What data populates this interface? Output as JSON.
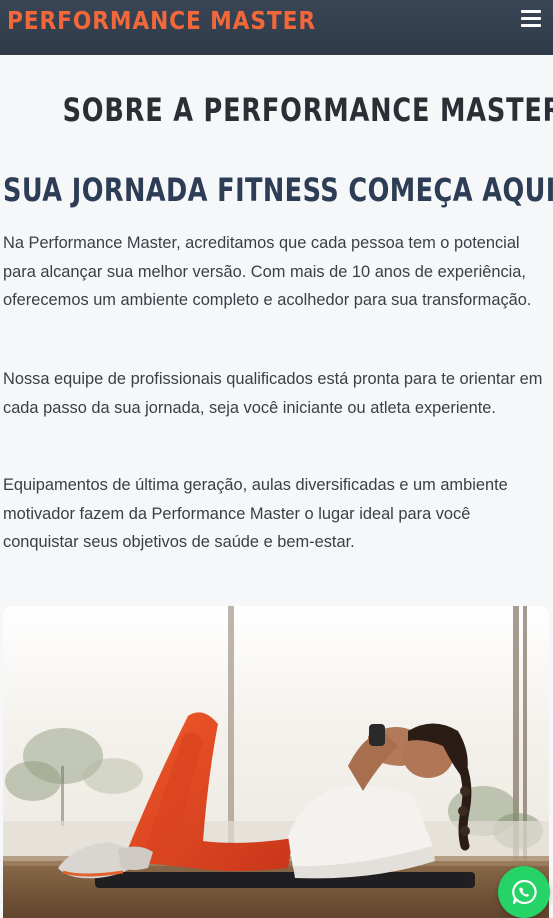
{
  "header": {
    "brand": "PERFORMANCE MASTER",
    "menu_icon": "hamburger-menu-icon",
    "brand_color": "#f2683a",
    "background_color": "#34404f"
  },
  "main": {
    "page_title": "SOBRE A PERFORMANCE MASTER",
    "section_title": "SUA JORNADA FITNESS COMEÇA AQUI",
    "paragraphs": [
      "Na Performance Master, acreditamos que cada pessoa tem o potencial para alcançar sua melhor versão. Com mais de 10 anos de experiência, oferecemos um ambiente completo e acolhedor para sua transformação.",
      "Nossa equipe de profissionais qualificados está pronta para te orientar em cada passo da sua jornada, seja você iniciante ou atleta experiente.",
      "Equipamentos de última geração, aulas diversificadas e um ambiente motivador fazem da Performance Master o lugar ideal para você conquistar seus objetivos de saúde e bem-estar."
    ],
    "title_color": "#2c3d55"
  },
  "floating": {
    "whatsapp_icon": "whatsapp-icon",
    "whatsapp_color": "#25d366"
  }
}
